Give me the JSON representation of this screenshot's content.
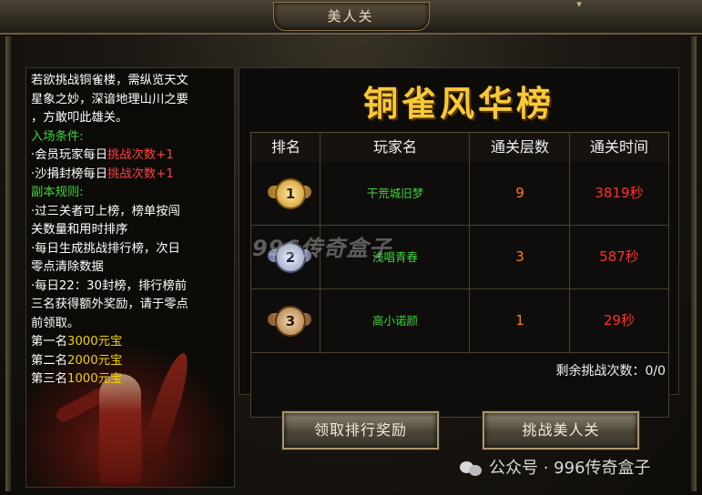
{
  "window": {
    "title": "美人关",
    "close_icon": "close-icon"
  },
  "left_panel": {
    "intro_lines": [
      "若欲挑战铜雀楼，需纵览天文",
      "星象之妙，深谙地理山川之要",
      "，方敢叩此雄关。"
    ],
    "entry_heading": "入场条件:",
    "entry_1_prefix": "·会员玩家每日",
    "entry_1_highlight": "挑战次数+1",
    "entry_2_prefix": "·沙捐封榜每日",
    "entry_2_highlight": "挑战次数+1",
    "rules_heading": "副本规则:",
    "rule_lines": [
      "·过三关者可上榜，榜单按闯",
      "关数量和用时排序",
      "·每日生成挑战排行榜，次日",
      "零点清除数据",
      "·每日22：30封榜，排行榜前",
      "三名获得额外奖励，请于零点",
      "前领取。"
    ],
    "reward_1_label": "第一名",
    "reward_1_value": "3000元宝",
    "reward_2_label": "第二名",
    "reward_2_value": "2000元宝",
    "reward_3_label": "第三名",
    "reward_3_value": "1000元宝"
  },
  "ranking": {
    "headline": "铜雀风华榜",
    "columns": [
      "排名",
      "玩家名",
      "通关层数",
      "通关时间"
    ],
    "rows": [
      {
        "rank": "1",
        "player": "干荒城旧梦",
        "layers": "9",
        "time": "3819秒"
      },
      {
        "rank": "2",
        "player": "浅唱青春",
        "layers": "3",
        "time": "587秒"
      },
      {
        "rank": "3",
        "player": "高小诺颜",
        "layers": "1",
        "time": "29秒"
      }
    ],
    "remaining": "剩余挑战次数：0/0",
    "watermark": "996传奇盒子"
  },
  "buttons": {
    "claim": "领取排行奖励",
    "challenge": "挑战美人关"
  },
  "footer_watermark": "公众号 · 996传奇盒子"
}
